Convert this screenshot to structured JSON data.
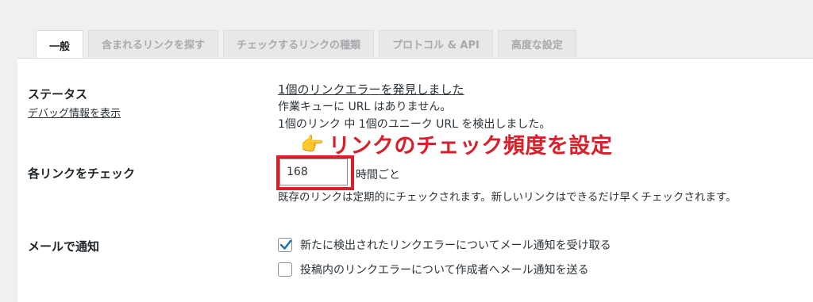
{
  "tabs": [
    {
      "label": "一般"
    },
    {
      "label": "含まれるリンクを探す"
    },
    {
      "label": "チェックするリンクの種類"
    },
    {
      "label": "プロトコル & API"
    },
    {
      "label": "高度な設定"
    }
  ],
  "status": {
    "label": "ステータス",
    "debug_link": "デバッグ情報を表示",
    "error_link": "1個のリンクエラーを発見しました",
    "queue_text": "作業キューに URL はありません。",
    "found_text": "1個のリンク 中 1個のユニーク URL を検出しました。"
  },
  "annotation": {
    "pointer_icon": "pointing-hand",
    "text": "リンクのチェック頻度を設定",
    "color": "#d6202a"
  },
  "check_each": {
    "label": "各リンクをチェック",
    "value": "168",
    "unit": "時間ごと",
    "description": "既存のリンクは定期的にチェックされます。新しいリンクはできるだけ早くチェックされます。"
  },
  "notify": {
    "label": "メールで通知",
    "option1": {
      "label": "新たに検出されたリンクエラーについてメール通知を受け取る",
      "checked": true
    },
    "option2": {
      "label": "投稿内のリンクエラーについて作成者へメール通知を送る",
      "checked": false
    }
  },
  "colors": {
    "link": "#2271b1",
    "accent_red": "#d6202a",
    "check_blue": "#2271b1"
  }
}
